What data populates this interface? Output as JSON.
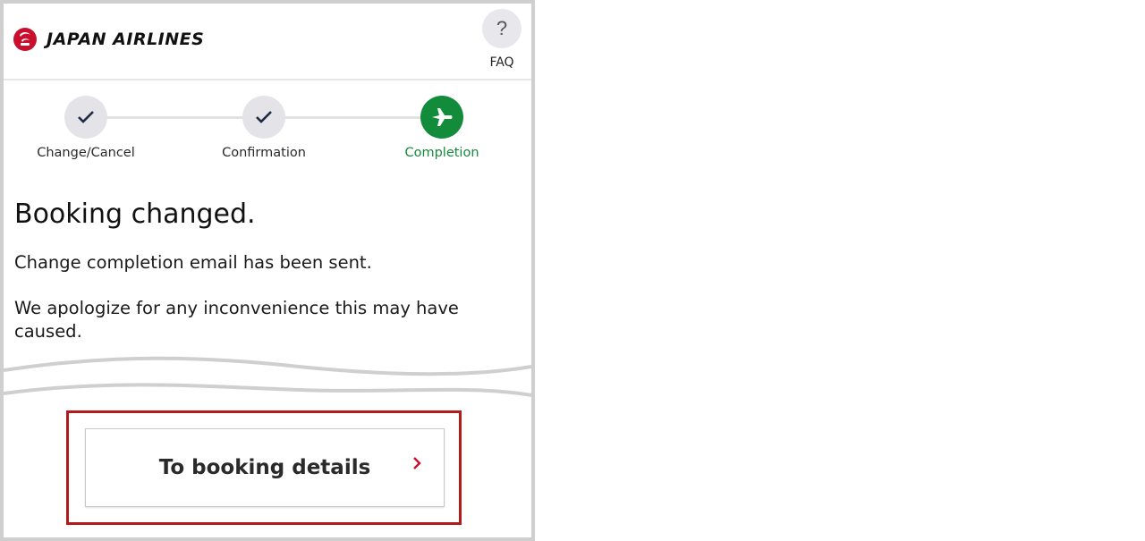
{
  "header": {
    "brand": "JAPAN AIRLINES",
    "faq_icon": "?",
    "faq_label": "FAQ"
  },
  "stepper": {
    "steps": [
      {
        "label": "Change/Cancel",
        "state": "done",
        "icon": "check-icon"
      },
      {
        "label": "Confirmation",
        "state": "done",
        "icon": "check-icon"
      },
      {
        "label": "Completion",
        "state": "active",
        "icon": "airplane-icon"
      }
    ]
  },
  "main": {
    "title": "Booking changed.",
    "message1": "Change completion email has been sent.",
    "message2": "We apologize for any inconvenience this may have caused."
  },
  "action": {
    "button_label": "To booking details",
    "chevron_icon": "chevron-right-icon"
  },
  "colors": {
    "brand_red": "#c8102e",
    "active_green": "#128c3a",
    "highlight_red": "#b31b1b",
    "chevron_red": "#c8102e"
  }
}
